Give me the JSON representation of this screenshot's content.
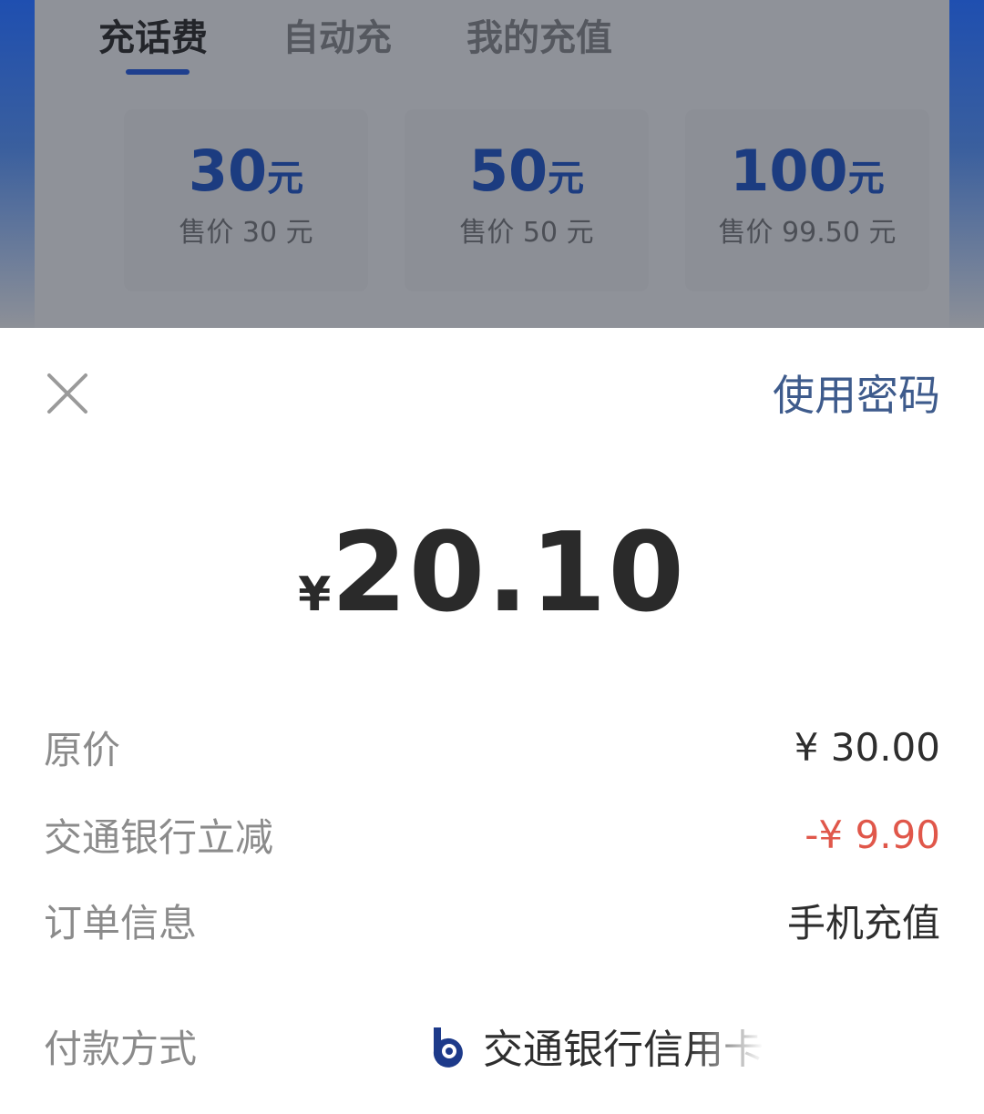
{
  "tabs": [
    {
      "label": "充话费",
      "active": true
    },
    {
      "label": "自动充",
      "active": false
    },
    {
      "label": "我的充值",
      "active": false
    }
  ],
  "amount_options": [
    {
      "amount": "30",
      "unit": "元",
      "price": "售价 30 元"
    },
    {
      "amount": "50",
      "unit": "元",
      "price": "售价 50 元"
    },
    {
      "amount": "100",
      "unit": "元",
      "price": "售价 99.50 元"
    }
  ],
  "sheet": {
    "close_icon": "close-icon",
    "use_password": "使用密码",
    "currency": "¥",
    "amount": "20.10",
    "rows": {
      "original_label": "原价",
      "original_value": "¥ 30.00",
      "discount_label": "交通银行立减",
      "discount_value": "-¥ 9.90",
      "order_label": "订单信息",
      "order_value": "手机充值",
      "method_label": "付款方式",
      "method_value": "交通银行信用卡"
    }
  },
  "colors": {
    "accent_blue": "#1f3f8e",
    "link_blue": "#3e5b8c",
    "discount_red": "#e0574a",
    "overlay_gray": "#8d9097"
  }
}
